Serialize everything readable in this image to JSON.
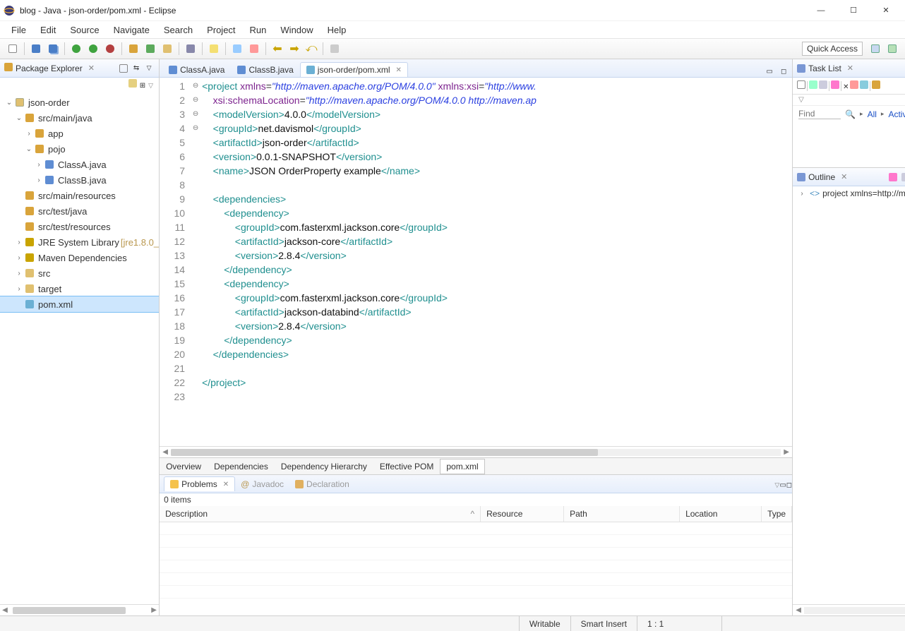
{
  "window": {
    "title": "blog - Java - json-order/pom.xml - Eclipse"
  },
  "menu": [
    "File",
    "Edit",
    "Source",
    "Navigate",
    "Search",
    "Project",
    "Run",
    "Window",
    "Help"
  ],
  "quick_access": "Quick Access",
  "views": {
    "package_explorer": "Package Explorer",
    "task_list": "Task List",
    "outline": "Outline",
    "problems": "Problems",
    "javadoc": "Javadoc",
    "declaration": "Declaration"
  },
  "explorer": {
    "project": "json-order",
    "src_main_java": "src/main/java",
    "pkg_app": "app",
    "pkg_pojo": "pojo",
    "classA": "ClassA.java",
    "classB": "ClassB.java",
    "src_main_resources": "src/main/resources",
    "src_test_java": "src/test/java",
    "src_test_resources": "src/test/resources",
    "jre": "JRE System Library",
    "jre_suffix": "[jre1.8.0_",
    "maven_deps": "Maven Dependencies",
    "src_folder": "src",
    "target": "target",
    "pom": "pom.xml"
  },
  "editor_tabs": {
    "a": "ClassA.java",
    "b": "ClassB.java",
    "pom": "json-order/pom.xml"
  },
  "code_lines": [
    {
      "n": 1,
      "f": "⊖",
      "html": "<span class='t-tag'>&lt;project</span> <span class='t-attr'>xmlns</span>=<span class='t-str'>\"http://maven.apache.org/POM/4.0.0\"</span> <span class='t-attr'>xmlns:xsi</span>=<span class='t-str'>\"http://www.</span>"
    },
    {
      "n": 2,
      "f": "",
      "html": "    <span class='t-attr'>xsi:schemaLocation</span>=<span class='t-str'>\"http://maven.apache.org/POM/4.0.0 http://maven.ap</span>"
    },
    {
      "n": 3,
      "f": "",
      "html": "    <span class='t-tag'>&lt;modelVersion&gt;</span><span class='t-txt'>4.0.0</span><span class='t-tag'>&lt;/modelVersion&gt;</span>"
    },
    {
      "n": 4,
      "f": "",
      "html": "    <span class='t-tag'>&lt;groupId&gt;</span><span class='t-txt'>net.davismol</span><span class='t-tag'>&lt;/groupId&gt;</span>"
    },
    {
      "n": 5,
      "f": "",
      "html": "    <span class='t-tag'>&lt;artifactId&gt;</span><span class='t-txt'>json-order</span><span class='t-tag'>&lt;/artifactId&gt;</span>"
    },
    {
      "n": 6,
      "f": "",
      "html": "    <span class='t-tag'>&lt;version&gt;</span><span class='t-txt'>0.0.1-SNAPSHOT</span><span class='t-tag'>&lt;/version&gt;</span>"
    },
    {
      "n": 7,
      "f": "",
      "html": "    <span class='t-tag'>&lt;name&gt;</span><span class='t-txt'>JSON OrderProperty example</span><span class='t-tag'>&lt;/name&gt;</span>"
    },
    {
      "n": 8,
      "f": "",
      "html": ""
    },
    {
      "n": 9,
      "f": "⊖",
      "html": "    <span class='t-tag'>&lt;dependencies&gt;</span>"
    },
    {
      "n": 10,
      "f": "⊖",
      "html": "        <span class='t-tag'>&lt;dependency&gt;</span>"
    },
    {
      "n": 11,
      "f": "",
      "html": "            <span class='t-tag'>&lt;groupId&gt;</span><span class='t-txt'>com.fasterxml.jackson.core</span><span class='t-tag'>&lt;/groupId&gt;</span>"
    },
    {
      "n": 12,
      "f": "",
      "html": "            <span class='t-tag'>&lt;artifactId&gt;</span><span class='t-txt'>jackson-core</span><span class='t-tag'>&lt;/artifactId&gt;</span>"
    },
    {
      "n": 13,
      "f": "",
      "html": "            <span class='t-tag'>&lt;version&gt;</span><span class='t-txt'>2.8.4</span><span class='t-tag'>&lt;/version&gt;</span>"
    },
    {
      "n": 14,
      "f": "",
      "html": "        <span class='t-tag'>&lt;/dependency&gt;</span>"
    },
    {
      "n": 15,
      "f": "⊖",
      "html": "        <span class='t-tag'>&lt;dependency&gt;</span>"
    },
    {
      "n": 16,
      "f": "",
      "html": "            <span class='t-tag'>&lt;groupId&gt;</span><span class='t-txt'>com.fasterxml.jackson.core</span><span class='t-tag'>&lt;/groupId&gt;</span>"
    },
    {
      "n": 17,
      "f": "",
      "html": "            <span class='t-tag'>&lt;artifactId&gt;</span><span class='t-txt'>jackson-databind</span><span class='t-tag'>&lt;/artifactId&gt;</span>"
    },
    {
      "n": 18,
      "f": "",
      "html": "            <span class='t-tag'>&lt;version&gt;</span><span class='t-txt'>2.8.4</span><span class='t-tag'>&lt;/version&gt;</span>"
    },
    {
      "n": 19,
      "f": "",
      "html": "        <span class='t-tag'>&lt;/dependency&gt;</span>"
    },
    {
      "n": 20,
      "f": "",
      "html": "    <span class='t-tag'>&lt;/dependencies&gt;</span>"
    },
    {
      "n": 21,
      "f": "",
      "html": ""
    },
    {
      "n": 22,
      "f": "",
      "html": "<span class='t-tag'>&lt;/project&gt;</span>"
    },
    {
      "n": 23,
      "f": "",
      "html": ""
    }
  ],
  "bottom_tabs": [
    "Overview",
    "Dependencies",
    "Dependency Hierarchy",
    "Effective POM",
    "pom.xml"
  ],
  "bottom_active": 4,
  "task": {
    "find_placeholder": "Find",
    "all": "All",
    "activate": "Activate..."
  },
  "outline_item": "project xmlns=http://maven.apach",
  "problems": {
    "count": "0 items",
    "cols": [
      "Description",
      "Resource",
      "Path",
      "Location",
      "Type"
    ]
  },
  "status": {
    "writable": "Writable",
    "insert": "Smart Insert",
    "pos": "1 : 1"
  }
}
